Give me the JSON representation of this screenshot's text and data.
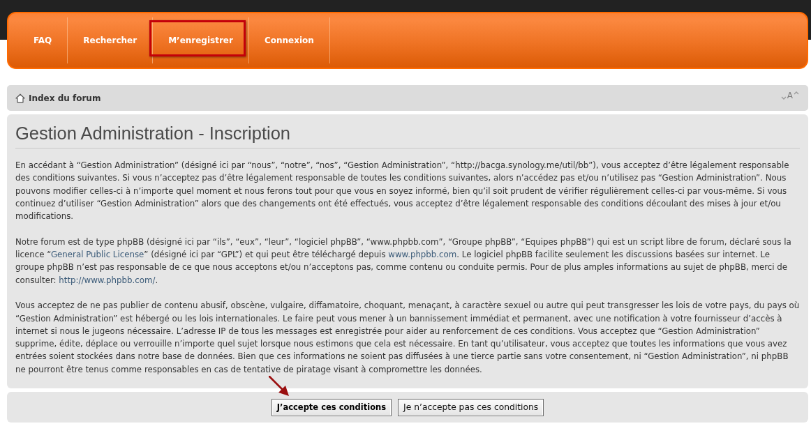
{
  "navbar": {
    "items": [
      {
        "label": "FAQ",
        "highlighted": false
      },
      {
        "label": "Rechercher",
        "highlighted": false
      },
      {
        "label": "M’enregistrer",
        "highlighted": true
      },
      {
        "label": "Connexion",
        "highlighted": false
      }
    ]
  },
  "breadcrumb": {
    "items": [
      {
        "label": "Index du forum"
      }
    ],
    "font_size_control": {
      "label": "A"
    }
  },
  "content": {
    "title": "Gestion Administration - Inscription",
    "paragraphs": [
      {
        "segments": [
          {
            "kind": "text",
            "text": "En accédant à “Gestion Administration” (désigné ici par “nous”, “notre”, “nos”, “Gestion Administration”, “http://bacga.synology.me/util/bb”), vous acceptez d’être légalement responsable des conditions suivantes. Si vous n’acceptez pas d’être légalement responsable de toutes les conditions suivantes, alors n’accédez pas et/ou n’utilisez pas “Gestion Administration”. Nous pouvons modifier celles-ci à n’importe quel moment et nous ferons tout pour que vous en soyez informé, bien qu’il soit prudent de vérifier régulièrement celles-ci par vous-même. Si vous continuez d’utiliser “Gestion Administration” alors que des changements ont été effectués, vous acceptez d’être légalement responsable des conditions découlant des mises à jour et/ou modifications."
          }
        ]
      },
      {
        "segments": [
          {
            "kind": "text",
            "text": "Notre forum est de type phpBB (désigné ici par “ils”, “eux”, “leur”, “logiciel phpBB”, “www.phpbb.com”, “Groupe phpBB”, “Equipes phpBB”) qui est un script libre de forum, déclaré sous la licence “"
          },
          {
            "kind": "link",
            "text": "General Public License"
          },
          {
            "kind": "text",
            "text": "” (désigné ici par “GPL”) et qui peut être téléchargé depuis "
          },
          {
            "kind": "link",
            "text": "www.phpbb.com"
          },
          {
            "kind": "text",
            "text": ". Le logiciel phpBB facilite seulement les discussions basées sur internet. Le groupe phpBB n’est pas responsable de ce que nous acceptons et/ou n’acceptons pas, comme contenu ou conduite permis. Pour de plus amples informations au sujet de phpBB, merci de consulter: "
          },
          {
            "kind": "link",
            "text": "http://www.phpbb.com/"
          },
          {
            "kind": "text",
            "text": "."
          }
        ]
      },
      {
        "segments": [
          {
            "kind": "text",
            "text": "Vous acceptez de ne pas publier de contenu abusif, obscène, vulgaire, diffamatoire, choquant, menaçant, à caractère sexuel ou autre qui peut transgresser les lois de votre pays, du pays où “Gestion Administration” est hébergé ou les lois internationales. Le faire peut vous mener à un bannissement immédiat et permanent, avec une notification à votre fournisseur d’accès à internet si nous le jugeons nécessaire. L’adresse IP de tous les messages est enregistrée pour aider au renforcement de ces conditions. Vous acceptez que “Gestion Administration” supprime, édite, déplace ou verrouille n’importe quel sujet lorsque nous estimons que cela est nécessaire. En tant qu’utilisateur, vous acceptez que toutes les informations que vous avez entrées soient stockées dans notre base de données. Bien que ces informations ne soient pas diffusées à une tierce partie sans votre consentement, ni “Gestion Administration”, ni phpBB ne pourront être tenus comme responsables en cas de tentative de piratage visant à compromettre les données."
          }
        ]
      }
    ]
  },
  "buttons": [
    {
      "label": "J’accepte ces conditions",
      "primary": true,
      "pointed_at": true
    },
    {
      "label": "Je n’accepte pas ces conditions",
      "primary": false,
      "pointed_at": false
    }
  ]
}
